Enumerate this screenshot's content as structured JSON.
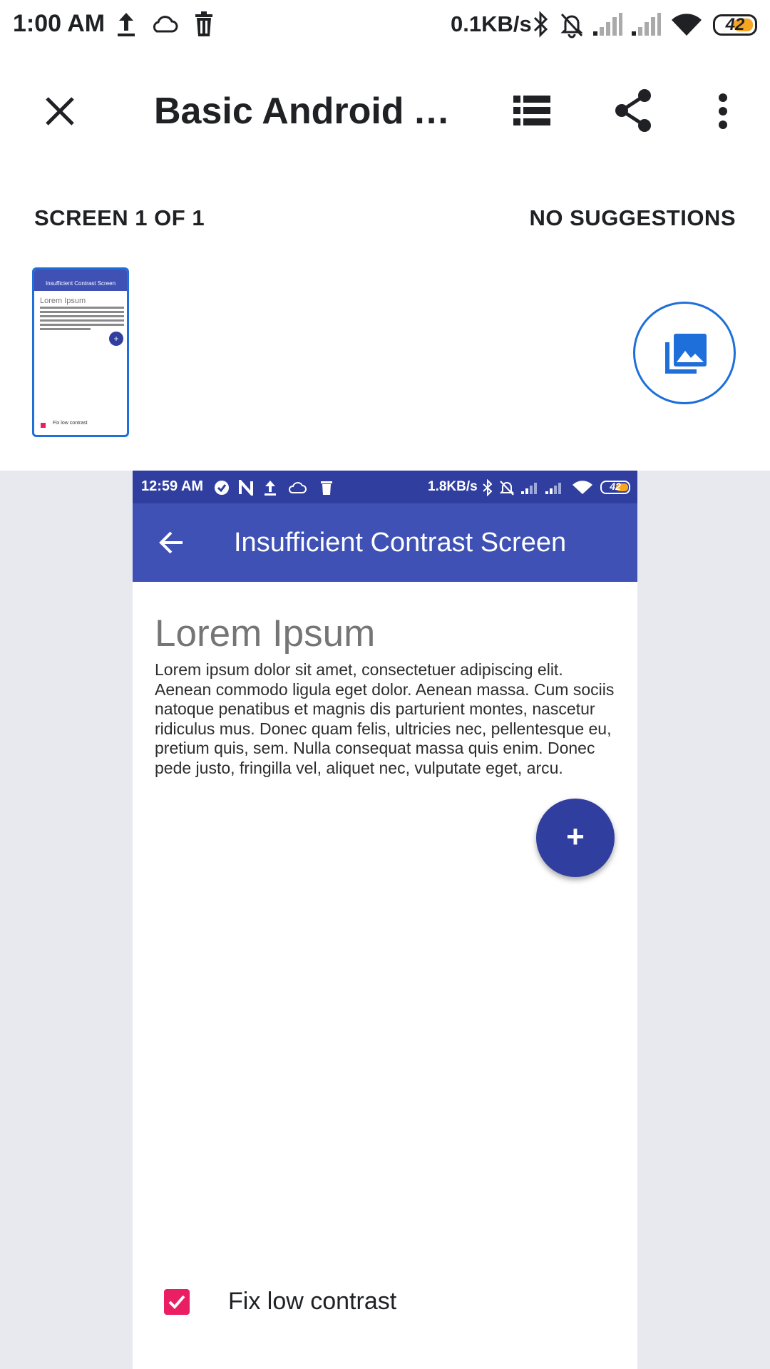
{
  "status_bar": {
    "time": "1:00 AM",
    "network_speed": "0.1KB/s",
    "battery": "42",
    "icons": [
      "upload-icon",
      "cloud-icon",
      "trash-icon",
      "bluetooth-icon",
      "bell-off-icon",
      "signal-icon",
      "signal-icon",
      "wifi-icon",
      "battery-icon"
    ]
  },
  "toolbar": {
    "title": "Basic Android A…",
    "icons": [
      "close-icon",
      "list-icon",
      "share-icon",
      "more-vert-icon"
    ]
  },
  "screen_counter": "SCREEN 1 OF 1",
  "suggestions": "NO SUGGESTIONS",
  "thumbnail": {
    "title": "Insufficient Contrast Screen",
    "heading": "Lorem Ipsum",
    "checkbox_label": "Fix low contrast"
  },
  "gallery_button_icon": "photo-library-icon",
  "preview": {
    "status_bar": {
      "time": "12:59 AM",
      "network_speed": "1.8KB/s",
      "battery": "42"
    },
    "app_bar": {
      "title": "Insufficient Contrast Screen",
      "back_icon": "arrow-back-icon"
    },
    "heading": "Lorem Ipsum",
    "body": "Lorem ipsum dolor sit amet, consectetuer adipiscing elit. Aenean commodo ligula eget dolor. Aenean massa. Cum sociis natoque penatibus et magnis dis parturient montes, nascetur ridiculus mus. Donec quam felis, ultricies nec, pellentesque eu, pretium quis, sem. Nulla consequat massa quis enim. Donec pede justo, fringilla vel, aliquet nec, vulputate eget, arcu.",
    "fab_label": "+",
    "checkbox": {
      "label": "Fix low contrast",
      "checked": true
    }
  },
  "colors": {
    "app_bar": "#3f51b5",
    "status_bar": "#303f9f",
    "fab": "#303f9f",
    "checkbox": "#e91e63",
    "accent_blue": "#1e6fd9",
    "preview_background": "#e8e9ee"
  }
}
